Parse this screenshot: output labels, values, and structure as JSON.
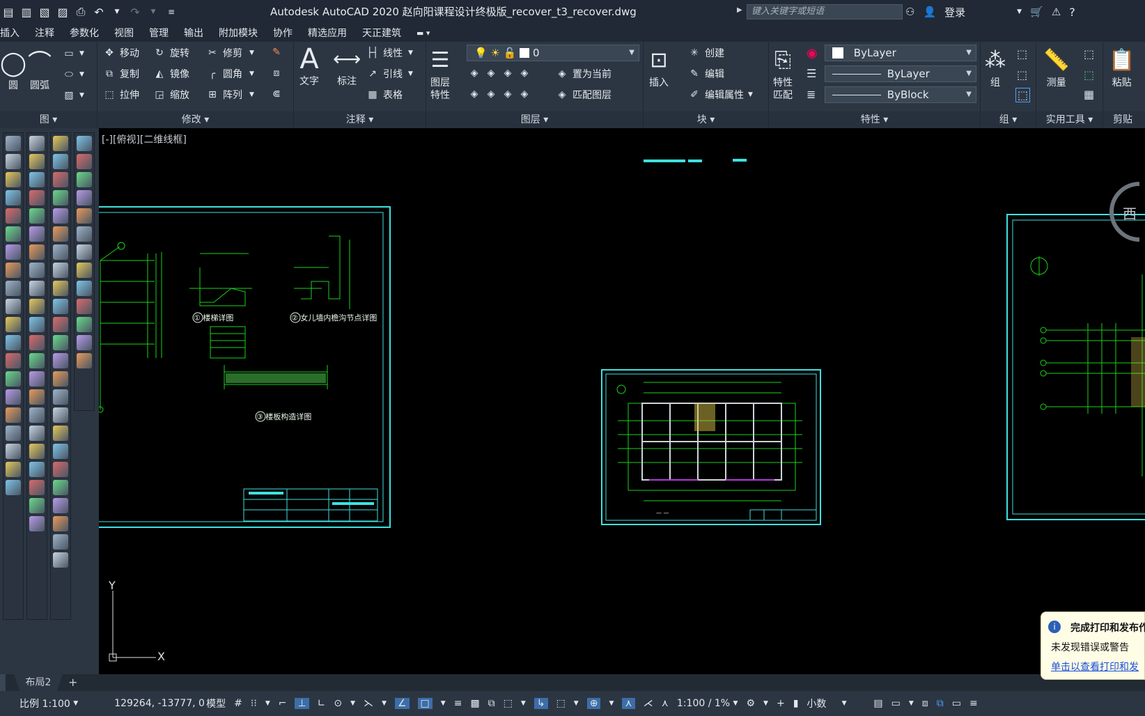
{
  "app": {
    "title": "Autodesk AutoCAD 2020    赵向阳课程设计终极版_recover_t3_recover.dwg",
    "search_placeholder": "键入关键字或短语",
    "login": "登录"
  },
  "menu": [
    "插入",
    "注释",
    "参数化",
    "视图",
    "管理",
    "输出",
    "附加模块",
    "协作",
    "精选应用",
    "天正建筑"
  ],
  "ribbon": {
    "draw": {
      "label": "图",
      "circle": "圆",
      "arc": "圆弧"
    },
    "modify": {
      "label": "修改",
      "move": "移动",
      "rotate": "旋转",
      "trim": "修剪",
      "copy": "复制",
      "mirror": "镜像",
      "fillet": "圆角",
      "stretch": "拉伸",
      "scale": "缩放",
      "array": "阵列"
    },
    "annotation": {
      "label": "注释",
      "text": "文字",
      "dimension": "标注",
      "linetype": "线性",
      "leader": "引线",
      "table": "表格"
    },
    "layers": {
      "label": "图层",
      "props_1": "图层",
      "props_2": "特性",
      "current_layer": "0",
      "set_current": "置为当前",
      "match_layer": "匹配图层"
    },
    "block": {
      "label": "块",
      "insert": "插入",
      "create": "创建",
      "edit": "编辑",
      "edit_attr": "编辑属性"
    },
    "properties": {
      "label": "特性",
      "match_1": "特性",
      "match_2": "匹配",
      "color": "ByLayer",
      "linetype": "ByLayer",
      "lineweight": "ByBlock"
    },
    "group": {
      "label": "组",
      "group": "组"
    },
    "utilities": {
      "label": "实用工具",
      "measure": "测量"
    },
    "clipboard": {
      "label": "剪贴",
      "paste": "粘贴"
    }
  },
  "canvas": {
    "viewport_label": "[-][俯视][二维线框]",
    "viewcube_label": "西",
    "ucs_x": "X",
    "ucs_y": "Y",
    "drawing1": {
      "caption1": "① 楼梯详图",
      "caption2": "② 女儿墙内檐沟节点详图",
      "caption3": "③ 楼板构造详图"
    }
  },
  "tabs": {
    "layout2": "布局2",
    "add": "+"
  },
  "status": {
    "scale": "比例 1:100",
    "coords": "129264, -13777, 0",
    "model": "模型",
    "annotation_scale": "1:100 / 1%",
    "units": "小数"
  },
  "notification": {
    "title": "完成打印和发布作",
    "line1": "未发现错误或警告",
    "link": "单击以查看打印和发"
  },
  "colors": {
    "cad_cyan": "#3fe0e0",
    "cad_green": "#19d419",
    "accent_blue": "#4ea0ff"
  }
}
